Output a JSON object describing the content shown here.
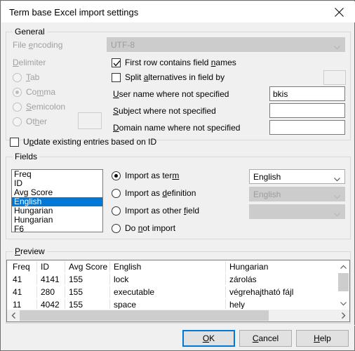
{
  "window": {
    "title": "Term base Excel import settings",
    "close_icon": "close-icon"
  },
  "general": {
    "legend": "General",
    "file_encoding_label": "File encoding",
    "file_encoding_value": "UTF-8",
    "delimiter_label": "Delimiter",
    "delimiter_options": [
      {
        "label": "Tab",
        "accel": "T",
        "selected": false
      },
      {
        "label": "Comma",
        "accel": "m",
        "selected": true
      },
      {
        "label": "Semicolon",
        "accel": "S",
        "selected": false
      },
      {
        "label": "Other",
        "accel": "h",
        "selected": false
      }
    ],
    "other_delimiter_value": "",
    "first_row_label": "First row contains field names",
    "first_row_checked": true,
    "split_alternatives_label": "Split alternatives in field by",
    "split_alternatives_checked": false,
    "split_alternatives_value": "",
    "user_name_label": "User name where not specified",
    "user_name_value": "bkis",
    "subject_label": "Subject where not specified",
    "subject_value": "",
    "domain_label": "Domain name where not specified",
    "domain_value": "",
    "update_existing_label": "Update existing entries based on ID",
    "update_existing_checked": false
  },
  "fields": {
    "legend": "Fields",
    "list_items": [
      {
        "label": "Freq",
        "selected": false
      },
      {
        "label": "ID",
        "selected": false
      },
      {
        "label": "Avg Score",
        "selected": false
      },
      {
        "label": "English",
        "selected": true
      },
      {
        "label": "Hungarian",
        "selected": false
      },
      {
        "label": "Hungarian",
        "selected": false
      },
      {
        "label": "F6",
        "selected": false
      }
    ],
    "options": [
      {
        "label": "Import as term",
        "selected": true
      },
      {
        "label": "Import as definition",
        "selected": false
      },
      {
        "label": "Import as other field",
        "selected": false
      },
      {
        "label": "Do not import",
        "selected": false
      }
    ],
    "term_language": "English",
    "definition_language": "English",
    "other_field_value": ""
  },
  "preview": {
    "legend": "Preview",
    "columns": [
      "Freq",
      "ID",
      "Avg Score",
      "English",
      "Hungarian"
    ],
    "rows": [
      [
        "41",
        "4141",
        "155",
        "lock",
        "zárolás"
      ],
      [
        "41",
        "280",
        "155",
        "executable",
        "végrehajtható fájl"
      ],
      [
        "11",
        "4042",
        "155",
        "space",
        "hely"
      ]
    ]
  },
  "footer": {
    "ok_label": "OK",
    "cancel_label": "Cancel",
    "help_label": "Help"
  },
  "colors": {
    "accent": "#0078d7",
    "dialog_bg": "#f0f0f0",
    "disabled_text": "#a0a0a0"
  }
}
